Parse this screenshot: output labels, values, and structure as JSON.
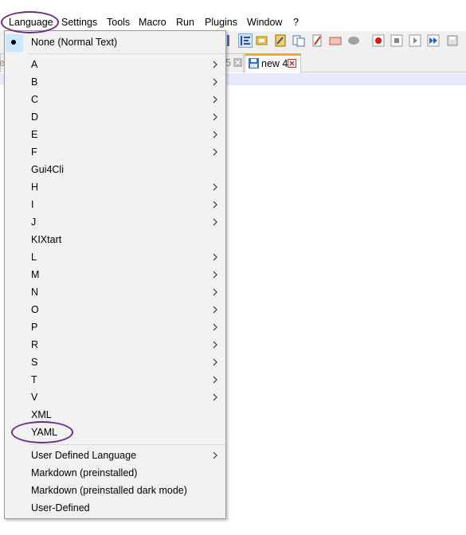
{
  "menubar": {
    "items": [
      "Language",
      "Settings",
      "Tools",
      "Macro",
      "Run",
      "Plugins",
      "Window",
      "?"
    ]
  },
  "tabs": [
    {
      "label": "e",
      "close": "x"
    },
    {
      "label": "5",
      "close": "x"
    },
    {
      "label": "new 4",
      "close": "x"
    }
  ],
  "language_menu": {
    "selected": "None (Normal Text)",
    "items": [
      {
        "label": "A",
        "submenu": true
      },
      {
        "label": "B",
        "submenu": true
      },
      {
        "label": "C",
        "submenu": true
      },
      {
        "label": "D",
        "submenu": true
      },
      {
        "label": "E",
        "submenu": true
      },
      {
        "label": "F",
        "submenu": true
      },
      {
        "label": "Gui4Cli",
        "submenu": false
      },
      {
        "label": "H",
        "submenu": true
      },
      {
        "label": "I",
        "submenu": true
      },
      {
        "label": "J",
        "submenu": true
      },
      {
        "label": "KIXtart",
        "submenu": false
      },
      {
        "label": "L",
        "submenu": true
      },
      {
        "label": "M",
        "submenu": true
      },
      {
        "label": "N",
        "submenu": true
      },
      {
        "label": "O",
        "submenu": true
      },
      {
        "label": "P",
        "submenu": true
      },
      {
        "label": "R",
        "submenu": true
      },
      {
        "label": "S",
        "submenu": true
      },
      {
        "label": "T",
        "submenu": true
      },
      {
        "label": "V",
        "submenu": true
      },
      {
        "label": "XML",
        "submenu": false
      },
      {
        "label": "YAML",
        "submenu": false
      }
    ],
    "bottom_items": [
      {
        "label": "User Defined Language",
        "submenu": true
      },
      {
        "label": "Markdown (preinstalled)",
        "submenu": false
      },
      {
        "label": "Markdown (preinstalled dark mode)",
        "submenu": false
      },
      {
        "label": "User-Defined",
        "submenu": false
      }
    ]
  },
  "highlight_color": "#6a2b8a",
  "icons": [
    "indent-guide-icon",
    "word-wrap-icon",
    "user-lang-icon",
    "doc-map-icon",
    "function-list-icon",
    "folder-icon",
    "monitor-icon",
    "record-macro-icon",
    "stop-record-icon",
    "play-macro-icon",
    "run-multiple-icon",
    "save-macro-icon"
  ]
}
